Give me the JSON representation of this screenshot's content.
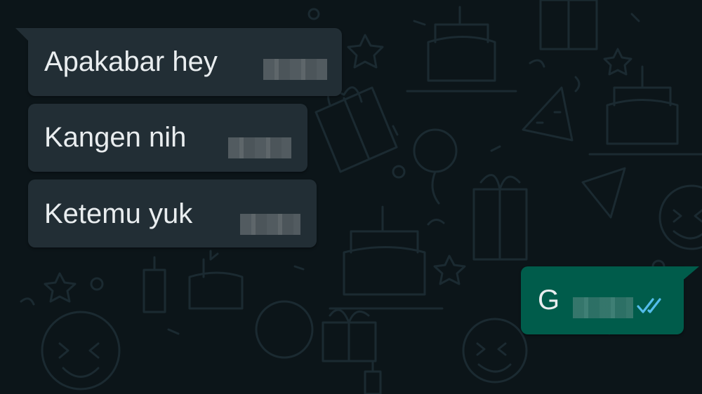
{
  "messages": [
    {
      "direction": "incoming",
      "text": "Apakabar hey"
    },
    {
      "direction": "incoming",
      "text": "Kangen nih"
    },
    {
      "direction": "incoming",
      "text": "Ketemu yuk"
    },
    {
      "direction": "outgoing",
      "text": "G",
      "status_icon": "double-check-read-icon"
    }
  ],
  "colors": {
    "background": "#0c1519",
    "incoming_bubble": "#222e35",
    "outgoing_bubble": "#005c4b",
    "read_ticks": "#53bdeb",
    "text": "#e9edef"
  }
}
